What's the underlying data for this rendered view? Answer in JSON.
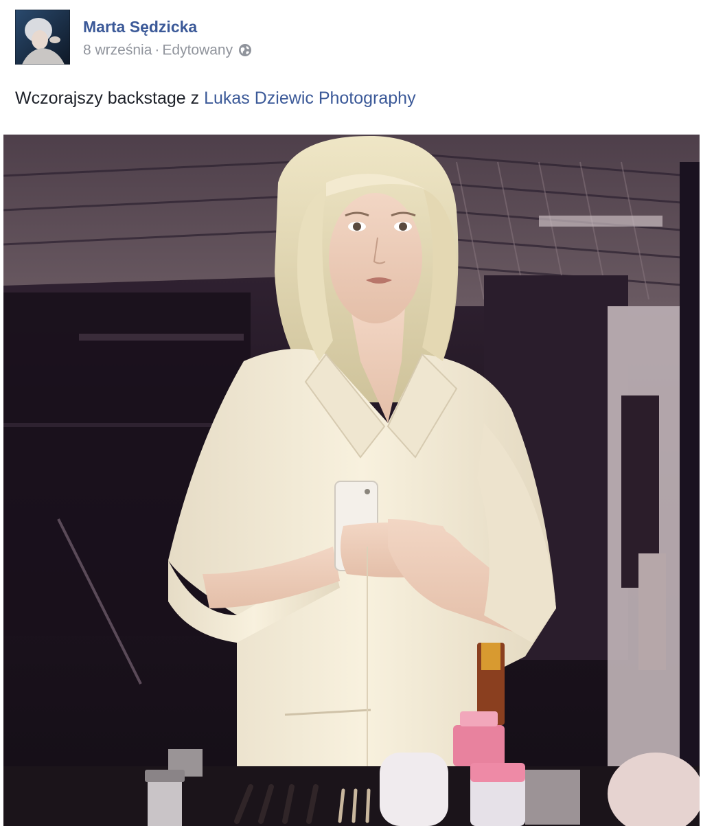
{
  "post": {
    "author": "Marta Sędzicka",
    "date": "8 września",
    "separator": "·",
    "edited": "Edytowany",
    "audience_icon": "globe-icon",
    "caption_text": "Wczorajszy backstage z ",
    "caption_tag": "Lukas Dziewic Photography",
    "photo_subject": "mirror-selfie-photo"
  },
  "colors": {
    "link": "#3b5998",
    "meta": "#90949c",
    "text": "#1d2129",
    "background": "#ffffff"
  }
}
